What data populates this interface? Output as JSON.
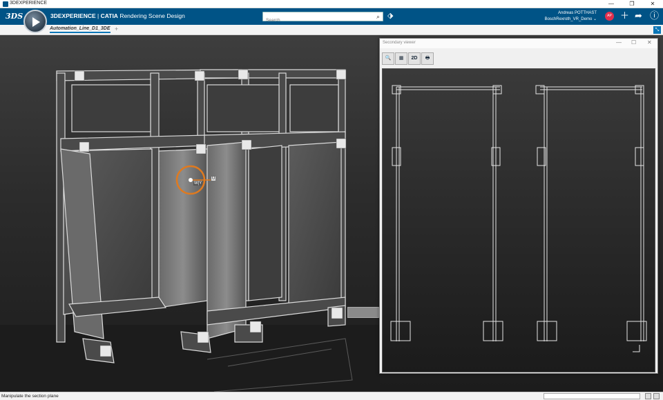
{
  "os_window": {
    "title": "3DEXPERIENCE",
    "minimize": "—",
    "restore": "❐",
    "close": "✕"
  },
  "top_bar": {
    "logo": "3DS",
    "brand_prefix": "3DEXPERIENCE",
    "separator": " | ",
    "brand_app": "CATIA",
    "brand_rest": " Rendering Scene Design",
    "search_placeholder": "Search",
    "user_name": "Andreas POTTHAST",
    "user_context": "BoschRexroth_VR_Demo ⌄",
    "avatar_initials": "AP",
    "icons": [
      "search-icon",
      "tag-icon",
      "add-icon",
      "share-icon",
      "help-icon"
    ]
  },
  "tab_bar": {
    "tabs": [
      {
        "label": "Automation_Line_D1_3DE",
        "active": true
      }
    ],
    "add_tab": "+",
    "collapse": "⤡"
  },
  "viewport": {
    "manipulator_label": "W|Y",
    "manipulator_axis": "U"
  },
  "secondary_viewer": {
    "title": "Secondary viewer",
    "window_buttons": {
      "minimize": "—",
      "maximize": "☐",
      "close": "✕"
    },
    "tools": [
      {
        "name": "search-tool",
        "glyph": "🔍"
      },
      {
        "name": "section-tool",
        "glyph": "▦"
      },
      {
        "name": "2d-mode-tool",
        "glyph": "2D"
      },
      {
        "name": "print-tool",
        "glyph": "🖶"
      }
    ]
  },
  "status_bar": {
    "message": "Manipulate the section plane"
  },
  "colors": {
    "header_blue": "#005386",
    "accent_blue": "#0a76b7",
    "avatar_red": "#e0304e",
    "manipulator_orange": "#e07a1f"
  }
}
